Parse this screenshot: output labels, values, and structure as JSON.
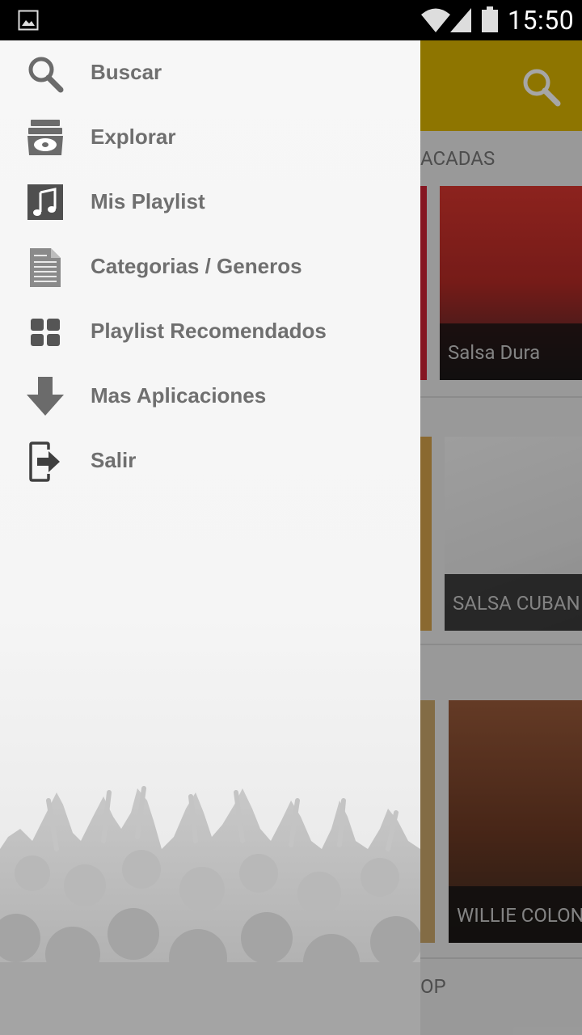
{
  "status_bar": {
    "time": "15:50",
    "icons": [
      "gallery-icon",
      "wifi-icon",
      "signal-icon",
      "battery-icon"
    ]
  },
  "drawer": {
    "items": [
      {
        "label": "Buscar",
        "icon": "search-icon"
      },
      {
        "label": "Explorar",
        "icon": "explore-icon"
      },
      {
        "label": "Mis Playlist",
        "icon": "music-note-icon"
      },
      {
        "label": "Categorias / Generos",
        "icon": "document-icon"
      },
      {
        "label": "Playlist Recomendados",
        "icon": "grid-icon"
      },
      {
        "label": "Mas Aplicaciones",
        "icon": "download-arrow-icon"
      },
      {
        "label": "Salir",
        "icon": "exit-icon"
      }
    ]
  },
  "background_app": {
    "header_color": "#dab400",
    "section_1_title": "ACADAS",
    "section_4_title": "OP",
    "cards": [
      {
        "caption": "Salsa Dura"
      },
      {
        "caption": "SALSA CUBAN"
      },
      {
        "caption": "WILLIE COLON"
      }
    ]
  }
}
